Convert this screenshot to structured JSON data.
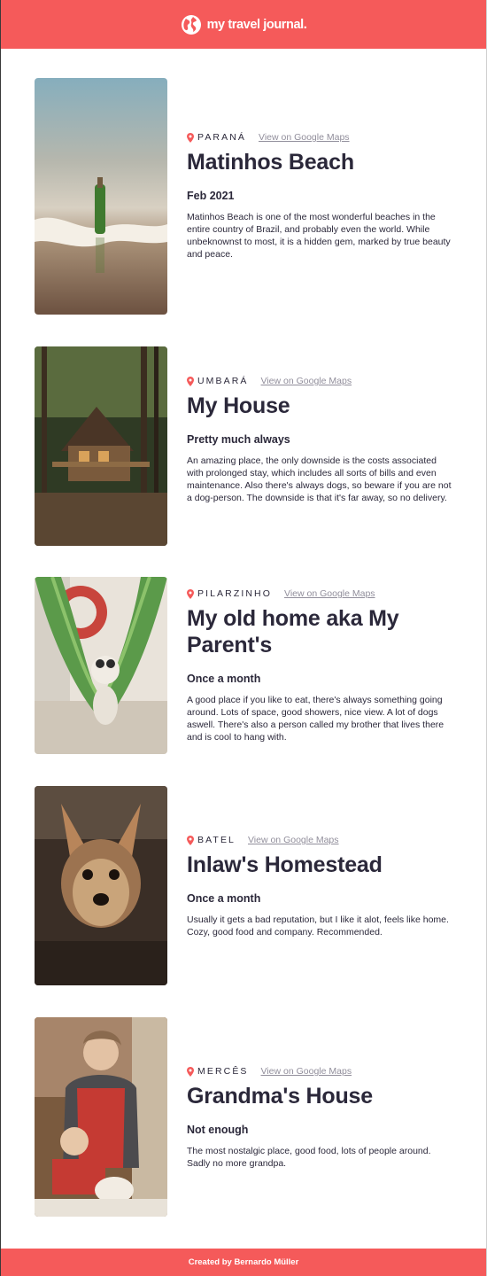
{
  "header": {
    "brand": "my travel journal.",
    "icon": "globe-icon"
  },
  "entries": [
    {
      "location": "PARANÁ",
      "maps_link": "View on Google Maps",
      "title": "Matinhos Beach",
      "dates": "Feb 2021",
      "description": "Matinhos Beach is one of the most wonderful beaches in the entire country of Brazil, and probably even the world. While unbeknownst to most, it is a hidden gem, marked by true beauty and peace."
    },
    {
      "location": "UMBARÁ",
      "maps_link": "View on Google Maps",
      "title": "My House",
      "dates": "Pretty much always",
      "description": "An amazing place, the only downside is the costs associated with prolonged stay, which includes all sorts of bills and even maintenance. Also there's always dogs, so beware if you are not a dog-person. The downside is that it's far away, so no delivery."
    },
    {
      "location": "PILARZINHO",
      "maps_link": "View on Google Maps",
      "title": "My old home aka My Parent's",
      "dates": "Once a month",
      "description": "A good place if you like to eat, there's always something going around. Lots of space, good showers, nice view. A lot of dogs aswell. There's also a person called my brother that lives there and is cool to hang with."
    },
    {
      "location": "BATEL",
      "maps_link": "View on Google Maps",
      "title": "Inlaw's Homestead",
      "dates": "Once a month",
      "description": "Usually it gets a bad reputation, but I like it alot, feels like home. Cozy, good food and company. Recommended."
    },
    {
      "location": "MERCÊS",
      "maps_link": "View on Google Maps",
      "title": "Grandma's House",
      "dates": "Not enough",
      "description": "The most nostalgic place, good food, lots of people around. Sadly no more grandpa."
    }
  ],
  "footer": {
    "credit": "Created by Bernardo Müller"
  },
  "colors": {
    "accent": "#f55a5a",
    "text": "#2b283a",
    "muted": "#918e9b"
  }
}
